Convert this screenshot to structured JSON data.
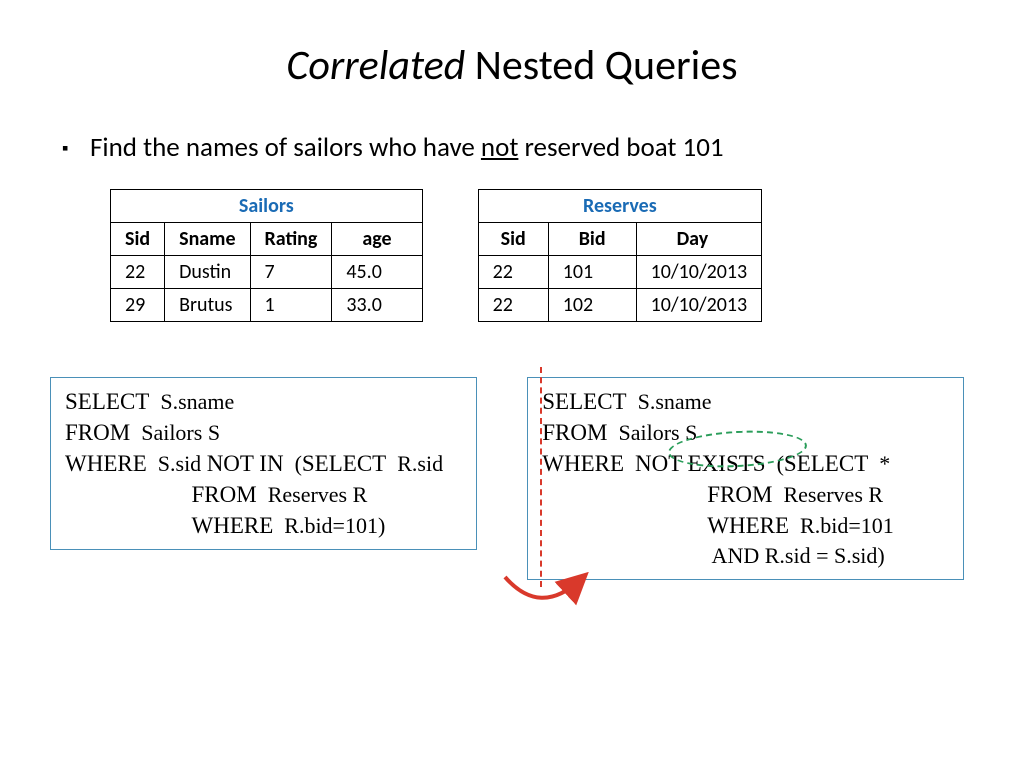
{
  "title": {
    "italic": "Correlated",
    "rest": " Nested Queries"
  },
  "bullet": {
    "pre": "Find the names of sailors who have ",
    "underlined": "not",
    "post": " reserved boat 101"
  },
  "tables": {
    "sailors": {
      "title": "Sailors",
      "headers": [
        "Sid",
        "Sname",
        "Rating",
        "age"
      ],
      "rows": [
        [
          "22",
          "Dustin",
          "7",
          "45.0"
        ],
        [
          "29",
          "Brutus",
          "1",
          "33.0"
        ]
      ]
    },
    "reserves": {
      "title": "Reserves",
      "headers": [
        "Sid",
        "Bid",
        "Day"
      ],
      "rows": [
        [
          "22",
          "101",
          "10/10/2013"
        ],
        [
          "22",
          "102",
          "10/10/2013"
        ]
      ]
    }
  },
  "query1": {
    "l1a": "SELECT",
    "l1b": "  S.sname",
    "l2a": "FROM",
    "l2b": "  Sailors S",
    "l3a": "WHERE",
    "l3b": "  S.sid ",
    "l3c": "NOT IN",
    "l3d": "  (",
    "l3e": "SELECT",
    "l3f": "  R.sid",
    "l4a": "                       ",
    "l4b": "FROM",
    "l4c": "  Reserves R",
    "l5a": "                       ",
    "l5b": "WHERE",
    "l5c": "  R.bid=101)"
  },
  "query2": {
    "l1a": "SELECT",
    "l1b": "  S.sname",
    "l2a": "FROM",
    "l2b": "  Sailors S",
    "l3a": "WHERE",
    "l3b": "  ",
    "l3c": "NOT EXISTS",
    "l3d": "  (",
    "l3e": "SELECT",
    "l3f": "  *",
    "l4a": "                              ",
    "l4b": "FROM",
    "l4c": "  Reserves R",
    "l5a": "                              ",
    "l5b": "WHERE",
    "l5c": "  R.bid=101",
    "l6a": "                              ",
    "l6b": " AND R.sid = S.sid)"
  }
}
